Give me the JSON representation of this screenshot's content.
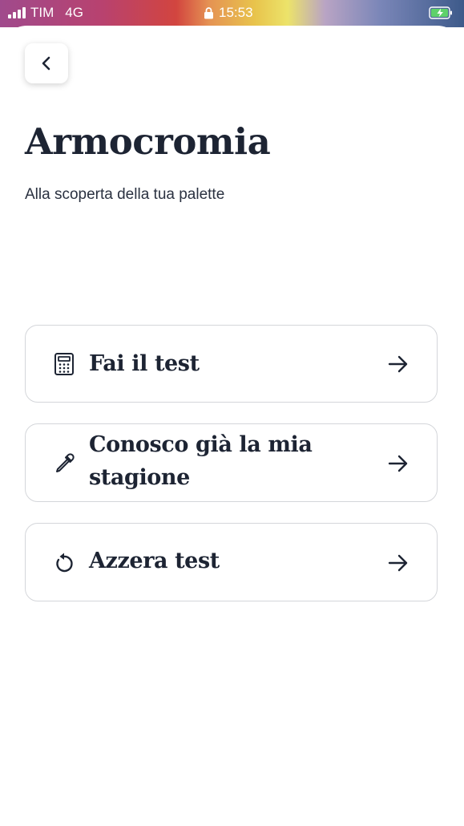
{
  "status_bar": {
    "carrier": "TIM",
    "network": "4G",
    "time": "15:53",
    "icons": [
      "signal-icon",
      "lock-icon",
      "battery-charging-icon"
    ]
  },
  "header": {
    "back_icon": "chevron-left-icon",
    "title": "Armocromia",
    "subtitle": "Alla scoperta della tua palette"
  },
  "options": [
    {
      "label": "Fai il test",
      "icon": "calculator-icon",
      "arrow": "arrow-right-icon"
    },
    {
      "label": "Conosco già la mia stagione",
      "icon": "eyedropper-icon",
      "arrow": "arrow-right-icon"
    },
    {
      "label": "Azzera test",
      "icon": "reset-icon",
      "arrow": "arrow-right-icon"
    }
  ],
  "colors": {
    "text_primary": "#1d2433",
    "card_border": "#d4d6da",
    "background": "#ffffff"
  }
}
